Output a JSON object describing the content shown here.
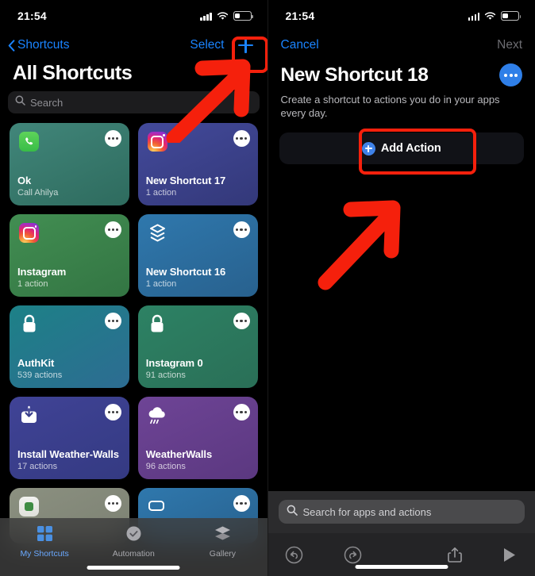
{
  "status": {
    "time": "21:54",
    "signal_icon": "cellular-signal-icon",
    "wifi_icon": "wifi-icon",
    "battery_icon": "battery-icon",
    "battery_level_pct": 32
  },
  "left_screen": {
    "nav": {
      "back_label": "Shortcuts",
      "back_icon": "chevron-left-icon",
      "select_label": "Select",
      "add_icon": "plus-icon",
      "highlight_color": "#f5200c"
    },
    "page_title": "All Shortcuts",
    "search": {
      "placeholder": "Search",
      "icon": "search-icon"
    },
    "shortcuts": [
      {
        "name": "Ok",
        "subtitle": "Call Ahilya",
        "icon": "phone-icon",
        "color_from": "#3f8271",
        "color_to": "#2f6f62"
      },
      {
        "name": "New Shortcut 17",
        "subtitle": "1 action",
        "icon": "instagram-icon",
        "color_from": "#3e4491",
        "color_to": "#343a80"
      },
      {
        "name": "Instagram",
        "subtitle": "1 action",
        "icon": "instagram-icon",
        "color_from": "#3f8a4d",
        "color_to": "#357a45"
      },
      {
        "name": "New Shortcut 16",
        "subtitle": "1 action",
        "icon": "layers-icon",
        "color_from": "#2f74a8",
        "color_to": "#2a6694"
      },
      {
        "name": "AuthKit",
        "subtitle": "539 actions",
        "icon": "lock-icon",
        "color_from": "#1f7f82",
        "color_to": "#2c6f8e"
      },
      {
        "name": "Instagram 0",
        "subtitle": "91 actions",
        "icon": "lock-icon",
        "color_from": "#2c7d61",
        "color_to": "#2a7059"
      },
      {
        "name": "Install Weather-Walls",
        "subtitle": "17 actions",
        "icon": "download-icon",
        "color_from": "#3d3f8f",
        "color_to": "#353a86"
      },
      {
        "name": "WeatherWalls",
        "subtitle": "96 actions",
        "icon": "rain-cloud-icon",
        "color_from": "#6a4090",
        "color_to": "#5d3a83"
      }
    ],
    "partial_row": [
      {
        "color_from": "#8a8f80",
        "color_to": "#7d8274"
      },
      {
        "color_from": "#2f74a8",
        "color_to": "#2a6694"
      }
    ],
    "more_icon": "ellipsis-icon",
    "tabs": [
      {
        "label": "My Shortcuts",
        "icon": "grid-icon",
        "active": true
      },
      {
        "label": "Automation",
        "icon": "clock-icon",
        "active": false
      },
      {
        "label": "Gallery",
        "icon": "layers-icon",
        "active": false
      }
    ]
  },
  "right_screen": {
    "nav": {
      "cancel_label": "Cancel",
      "next_label": "Next"
    },
    "page_title": "New Shortcut 18",
    "more_icon": "ellipsis-circle-icon",
    "description": "Create a shortcut to actions you do in your apps every day.",
    "add_action": {
      "label": "Add Action",
      "icon": "plus-circle-icon",
      "highlight_color": "#f5200c"
    },
    "search": {
      "placeholder": "Search for apps and actions",
      "icon": "search-icon"
    },
    "toolbar": [
      {
        "icon": "undo-icon"
      },
      {
        "icon": "redo-icon"
      },
      {
        "icon": "share-icon"
      },
      {
        "icon": "play-icon"
      }
    ]
  },
  "annotations": {
    "arrow_color": "#f5200c",
    "left_arrow": "points-to-plus-button",
    "right_arrow": "points-to-add-action-button"
  }
}
